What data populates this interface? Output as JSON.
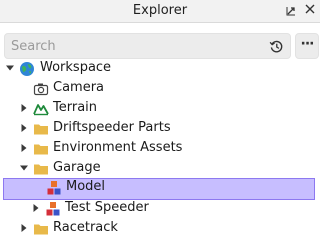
{
  "window": {
    "title": "Explorer"
  },
  "search": {
    "placeholder": "Search"
  },
  "tree": {
    "items": [
      {
        "label": "Workspace",
        "icon": "globe-icon",
        "expanded": true
      },
      {
        "label": "Camera",
        "icon": "camera-icon"
      },
      {
        "label": "Terrain",
        "icon": "terrain-icon",
        "expanded": false
      },
      {
        "label": "Driftspeeder Parts",
        "icon": "folder-icon",
        "expanded": false
      },
      {
        "label": "Environment Assets",
        "icon": "folder-icon",
        "expanded": false
      },
      {
        "label": "Garage",
        "icon": "folder-icon",
        "expanded": true
      },
      {
        "label": "Model",
        "icon": "model-icon",
        "selected": true
      },
      {
        "label": "Test Speeder",
        "icon": "model-icon",
        "expanded": false
      },
      {
        "label": "Racetrack",
        "icon": "folder-icon",
        "expanded": false
      }
    ]
  },
  "colors": {
    "selection_fill": "#c7beff",
    "selection_border": "#8d78f0",
    "folder": "#e8b94a",
    "titlebar": "#f2f2f2"
  }
}
